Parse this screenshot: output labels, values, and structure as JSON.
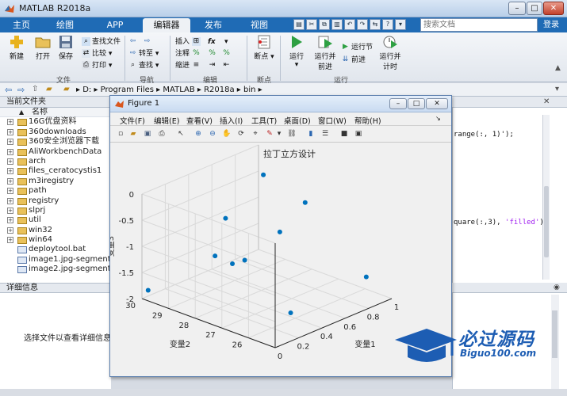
{
  "window": {
    "title": "MATLAB R2018a",
    "controls": [
      "–",
      "□",
      "✕"
    ]
  },
  "tabs": [
    {
      "label": "主页",
      "active": false
    },
    {
      "label": "绘图",
      "active": false
    },
    {
      "label": "APP",
      "active": false
    },
    {
      "label": "编辑器",
      "active": true
    },
    {
      "label": "发布",
      "active": false
    },
    {
      "label": "视图",
      "active": false
    }
  ],
  "search": {
    "placeholder": "搜索文档"
  },
  "login_label": "登录",
  "toolstrip": {
    "file": {
      "new": "新建",
      "open": "打开",
      "save": "保存",
      "find_files": "查找文件",
      "compare": "比较",
      "print": "打印",
      "group": "文件"
    },
    "nav": {
      "goto": "转至",
      "find": "查找",
      "group": "导航"
    },
    "edit": {
      "insert": "插入",
      "comment": "注释",
      "indent": "缩进",
      "fx": "fx",
      "group": "编辑"
    },
    "breakpoints": {
      "label": "断点",
      "group": "断点"
    },
    "run": {
      "run": "运行",
      "run_advance": "运行并\n前进",
      "run_section": "运行节",
      "advance": "前进",
      "run_time": "运行并\n计时",
      "group": "运行"
    }
  },
  "address": {
    "path": [
      "D:",
      "Program Files",
      "MATLAB",
      "R2018a",
      "bin"
    ]
  },
  "current_folder": {
    "header": "当前文件夹",
    "column": "名称",
    "items": [
      {
        "name": "16G优盘资料",
        "type": "folder"
      },
      {
        "name": "360downloads",
        "type": "folder"
      },
      {
        "name": "360安全浏览器下载",
        "type": "folder"
      },
      {
        "name": "AliWorkbenchData",
        "type": "folder"
      },
      {
        "name": "arch",
        "type": "folder"
      },
      {
        "name": "files_ceratocystis1",
        "type": "folder"
      },
      {
        "name": "m3iregistry",
        "type": "folder"
      },
      {
        "name": "path",
        "type": "folder"
      },
      {
        "name": "registry",
        "type": "folder"
      },
      {
        "name": "slprj",
        "type": "folder"
      },
      {
        "name": "util",
        "type": "folder"
      },
      {
        "name": "win32",
        "type": "folder"
      },
      {
        "name": "win64",
        "type": "folder"
      },
      {
        "name": "deploytool.bat",
        "type": "file"
      },
      {
        "name": "image1.jpg-segmente...",
        "type": "file"
      },
      {
        "name": "image2.jpg-segmente...",
        "type": "file"
      }
    ]
  },
  "details": {
    "header": "详细信息",
    "empty_text": "选择文件以查看详细信息"
  },
  "editor": {
    "line1": "range(:, 1)');",
    "line2_a": "quare(:,3), ",
    "line2_str": "'filled'",
    "line2_b": ")"
  },
  "figure": {
    "title": "Figure 1",
    "menu": [
      "文件(F)",
      "编辑(E)",
      "查看(V)",
      "插入(I)",
      "工具(T)",
      "桌面(D)",
      "窗口(W)",
      "帮助(H)"
    ]
  },
  "chart_data": {
    "type": "scatter",
    "title": "拉丁立方设计",
    "xlabel": "变量1",
    "ylabel": "变量2",
    "zlabel": "变量3",
    "xlim": [
      0,
      1
    ],
    "ylim": [
      25,
      30
    ],
    "zlim": [
      -2,
      0
    ],
    "xticks": [
      "0",
      "0.2",
      "0.4",
      "0.6",
      "0.8",
      "1"
    ],
    "yticks": [
      "26",
      "27",
      "28",
      "29",
      "30"
    ],
    "zticks": [
      "-2",
      "-1.5",
      "-1",
      "-0.5",
      "0"
    ],
    "grid": true,
    "marker_color": "#0072bd",
    "points": [
      {
        "x": 0.1,
        "y": 27.3,
        "z": -0.05
      },
      {
        "x": 0.95,
        "y": 29.6,
        "z": -0.45
      },
      {
        "x": 0.68,
        "y": 27.8,
        "z": -0.95
      },
      {
        "x": 0.76,
        "y": 27.2,
        "z": -0.35
      },
      {
        "x": 0.33,
        "y": 28.7,
        "z": -1.25
      },
      {
        "x": 0.63,
        "y": 28.9,
        "z": -1.65
      },
      {
        "x": 0.57,
        "y": 29.1,
        "z": -1.7
      },
      {
        "x": 0.85,
        "y": 25.3,
        "z": -1.5
      },
      {
        "x": 0.03,
        "y": 29.9,
        "z": -1.85
      },
      {
        "x": 0.27,
        "y": 25.6,
        "z": -1.7
      }
    ]
  },
  "watermark": {
    "brand": "必过源码",
    "url": "Biguo100.com"
  }
}
